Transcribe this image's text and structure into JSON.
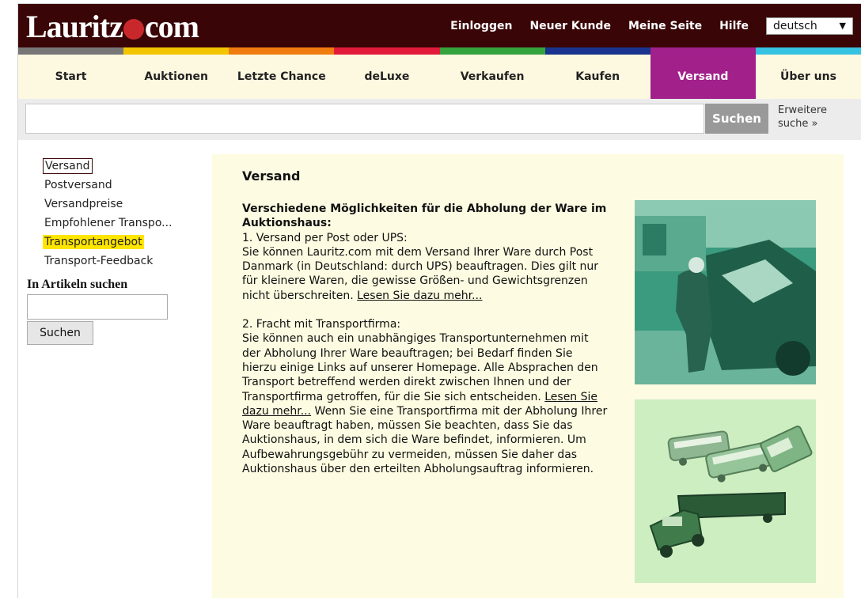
{
  "header": {
    "logo": "Lauritz.com",
    "nav": [
      "Einloggen",
      "Neuer Kunde",
      "Meine Seite",
      "Hilfe"
    ],
    "language": "deutsch",
    "colorbar": [
      "#777777",
      "#f2c500",
      "#f07c10",
      "#e31b3b",
      "#35a33b",
      "#19338f",
      "#a1208a",
      "#36c2e1"
    ]
  },
  "mainnav": {
    "items": [
      "Start",
      "Auktionen",
      "Letzte Chance",
      "deLuxe",
      "Verkaufen",
      "Kaufen",
      "Versand",
      "Über uns"
    ],
    "active": "Versand"
  },
  "search": {
    "button": "Suchen",
    "advanced": "Erweitere suche »"
  },
  "sidebar": {
    "links": [
      "Versand",
      "Postversand",
      "Versandpreise",
      "Empfohlener Transpo...",
      "Transportangebot",
      "Transport-Feedback"
    ],
    "heading": "In Artikeln suchen",
    "button": "Suchen"
  },
  "content": {
    "title": "Versand",
    "intro_bold": "Verschiedene Möglichkeiten für die Abholung der Ware im Auktionshaus:",
    "s1_title": "1. Versand per Post oder UPS:",
    "s1_text": "Sie können Lauritz.com mit dem Versand Ihrer Ware durch Post Danmark (in Deutschland: durch UPS) beauftragen. Dies gilt nur für kleinere Waren, die gewisse Größen- und Gewichtsgrenzen nicht überschreiten.",
    "s1_link": "Lesen Sie dazu mehr...",
    "s2_title": "2. Fracht mit Transportfirma:",
    "s2_text": "Sie können auch ein unabhängiges Transportunternehmen mit der Abholung Ihrer Ware beauftragen; bei Bedarf finden Sie hierzu einige Links auf unserer Homepage. Alle Absprachen den Transport betreffend werden direkt zwischen Ihnen und der Transportfirma getroffen, für die Sie sich entscheiden.",
    "s2_link": "Lesen Sie dazu mehr...",
    "s2_text_after": "Wenn Sie eine Transportfirma mit der Abholung Ihrer Ware beauftragt haben, müssen Sie beachten, dass Sie das Auktionshaus, in dem sich die Ware befindet, informieren. Um Aufbewahrungsgebühr zu vermeiden, müssen Sie daher das Auktionshaus über den erteilten Abholungsauftrag informieren."
  }
}
